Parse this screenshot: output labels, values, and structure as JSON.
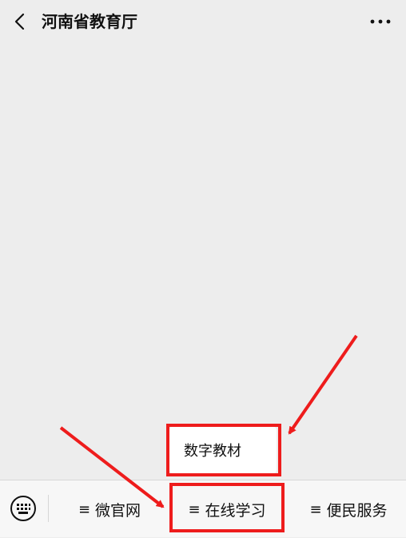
{
  "header": {
    "title": "河南省教育厅",
    "back_icon": "chevron-left-icon",
    "more_icon": "more-dots-icon"
  },
  "popup": {
    "item_label": "数字教材"
  },
  "bottom_menu": {
    "keyboard_icon": "keyboard-icon",
    "menu_mark": "≡",
    "tabs": [
      {
        "label": "微官网"
      },
      {
        "label": "在线学习"
      },
      {
        "label": "便民服务"
      }
    ]
  },
  "colors": {
    "background": "#ededed",
    "bar": "#f7f7f7",
    "annotation": "#ee1c1c",
    "text": "#111111"
  }
}
